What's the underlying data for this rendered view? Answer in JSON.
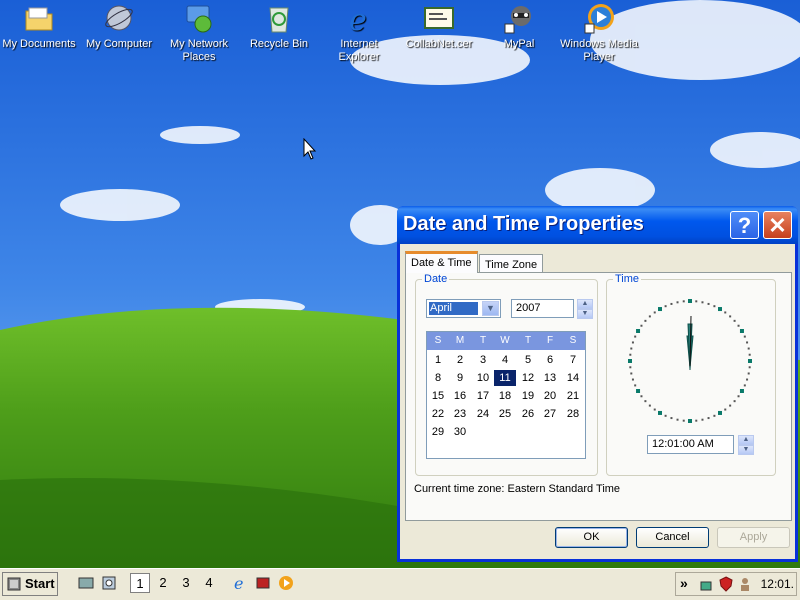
{
  "desktop": {
    "icons": [
      {
        "label": "My Documents"
      },
      {
        "label": "My Computer"
      },
      {
        "label": "My Network Places"
      },
      {
        "label": "Recycle Bin"
      },
      {
        "label": "Internet Explorer"
      },
      {
        "label": "CollabNet.cer"
      },
      {
        "label": "MyPal"
      },
      {
        "label": "Windows Media Player"
      }
    ]
  },
  "dialog": {
    "title": "Date and Time Properties",
    "help": "?",
    "close": "✕",
    "tabs": [
      "Date & Time",
      "Time Zone"
    ],
    "date_group": {
      "legend": "Date",
      "month": "April",
      "year": "2007",
      "day_headers": [
        "S",
        "M",
        "T",
        "W",
        "T",
        "F",
        "S"
      ],
      "weeks": [
        [
          "",
          "1",
          "2",
          "3",
          "4",
          "5",
          "6",
          "7"
        ],
        [
          "8",
          "9",
          "10",
          "11",
          "12",
          "13",
          "14"
        ],
        [
          "15",
          "16",
          "17",
          "18",
          "19",
          "20",
          "21"
        ],
        [
          "22",
          "23",
          "24",
          "25",
          "26",
          "27",
          "28"
        ],
        [
          "29",
          "30"
        ]
      ],
      "selected_day": "11"
    },
    "time_group": {
      "legend": "Time",
      "time": "12:01:00 AM"
    },
    "current_tz_label": "Current time zone:",
    "current_tz_value": "Eastern Standard Time",
    "buttons": {
      "ok": "OK",
      "cancel": "Cancel",
      "apply": "Apply"
    }
  },
  "taskbar": {
    "start": "Start",
    "workspaces": [
      "1",
      "2",
      "3",
      "4"
    ],
    "tray_chevron": "»",
    "clock": "12:01."
  }
}
